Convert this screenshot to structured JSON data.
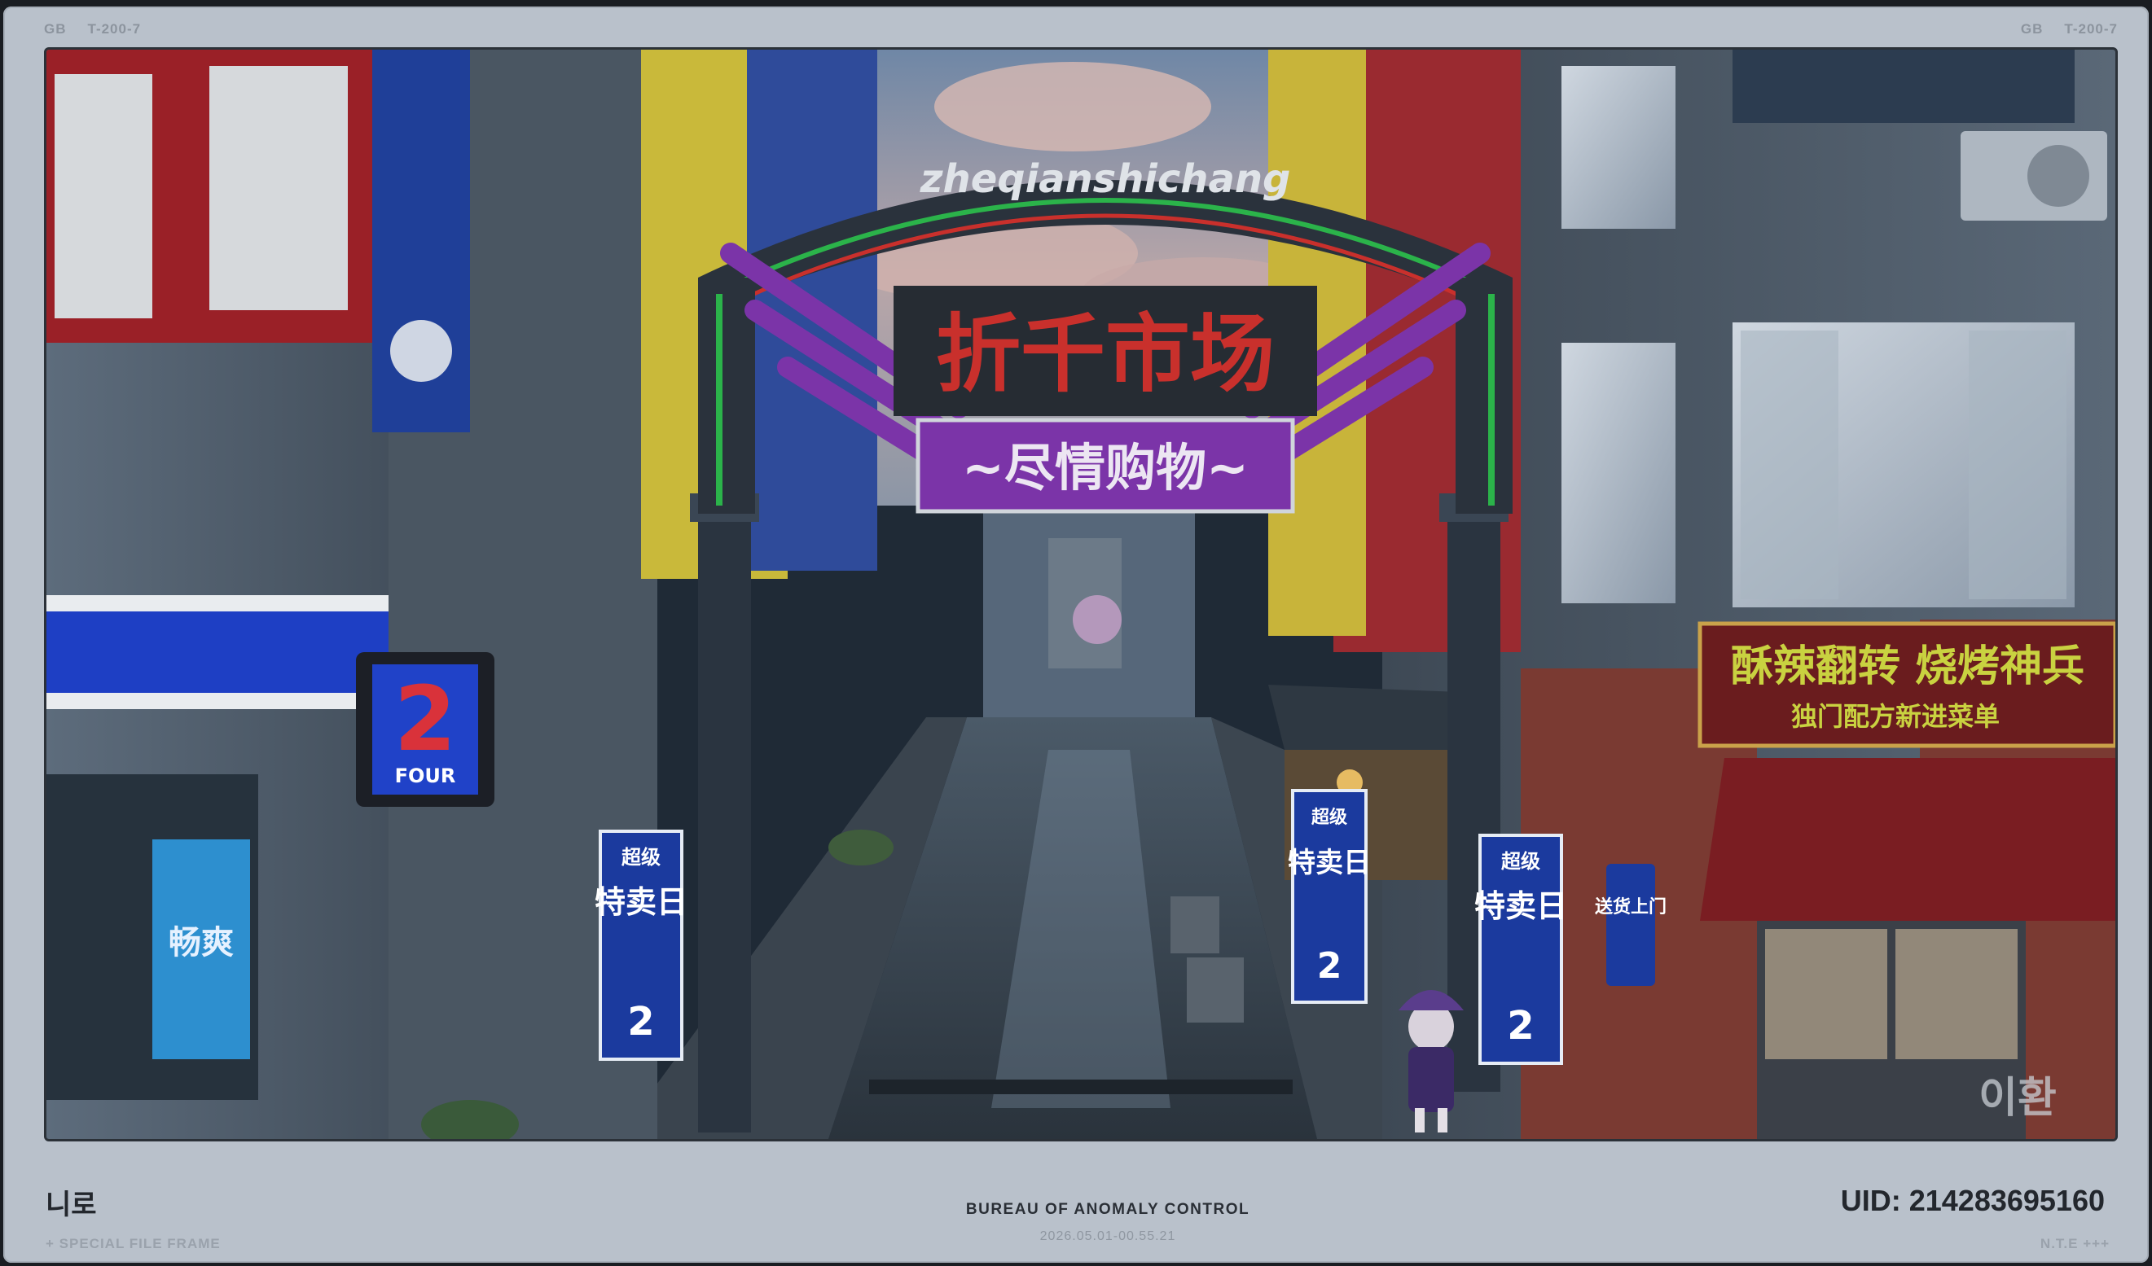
{
  "corner_tags": {
    "left_region": "GB",
    "left_code": "T-200-7",
    "right_region": "GB",
    "right_code": "T-200-7"
  },
  "scene": {
    "arch_romanized": "zheqianshichang",
    "arch_title": "折千市场",
    "arch_slogan": "~尽情购物~",
    "store_sign": "2",
    "store_sign_sub": "FOUR",
    "shop_sign_main": "酥辣翻转 烧烤神兵",
    "shop_sign_sub": "独门配方新进菜单",
    "banner_top": "超级",
    "banner_main": "特卖日",
    "banner_brand": "2",
    "delivery_sign": "送货上门",
    "fridge_label": "畅爽",
    "watermark": "이환",
    "colors": {
      "purple": "#7b34a8",
      "neon_red": "#c9302c",
      "banner_blue": "#1b3a9e",
      "store_blue": "#1e3fc4",
      "awning_red": "#7a1d22"
    }
  },
  "footer": {
    "player_name": "니로",
    "note_left": "+ SPECIAL FILE FRAME",
    "title": "BUREAU OF ANOMALY CONTROL",
    "timestamp": "2026.05.01-00.55.21",
    "uid": "UID: 214283695160",
    "note_right": "N.T.E +++"
  }
}
